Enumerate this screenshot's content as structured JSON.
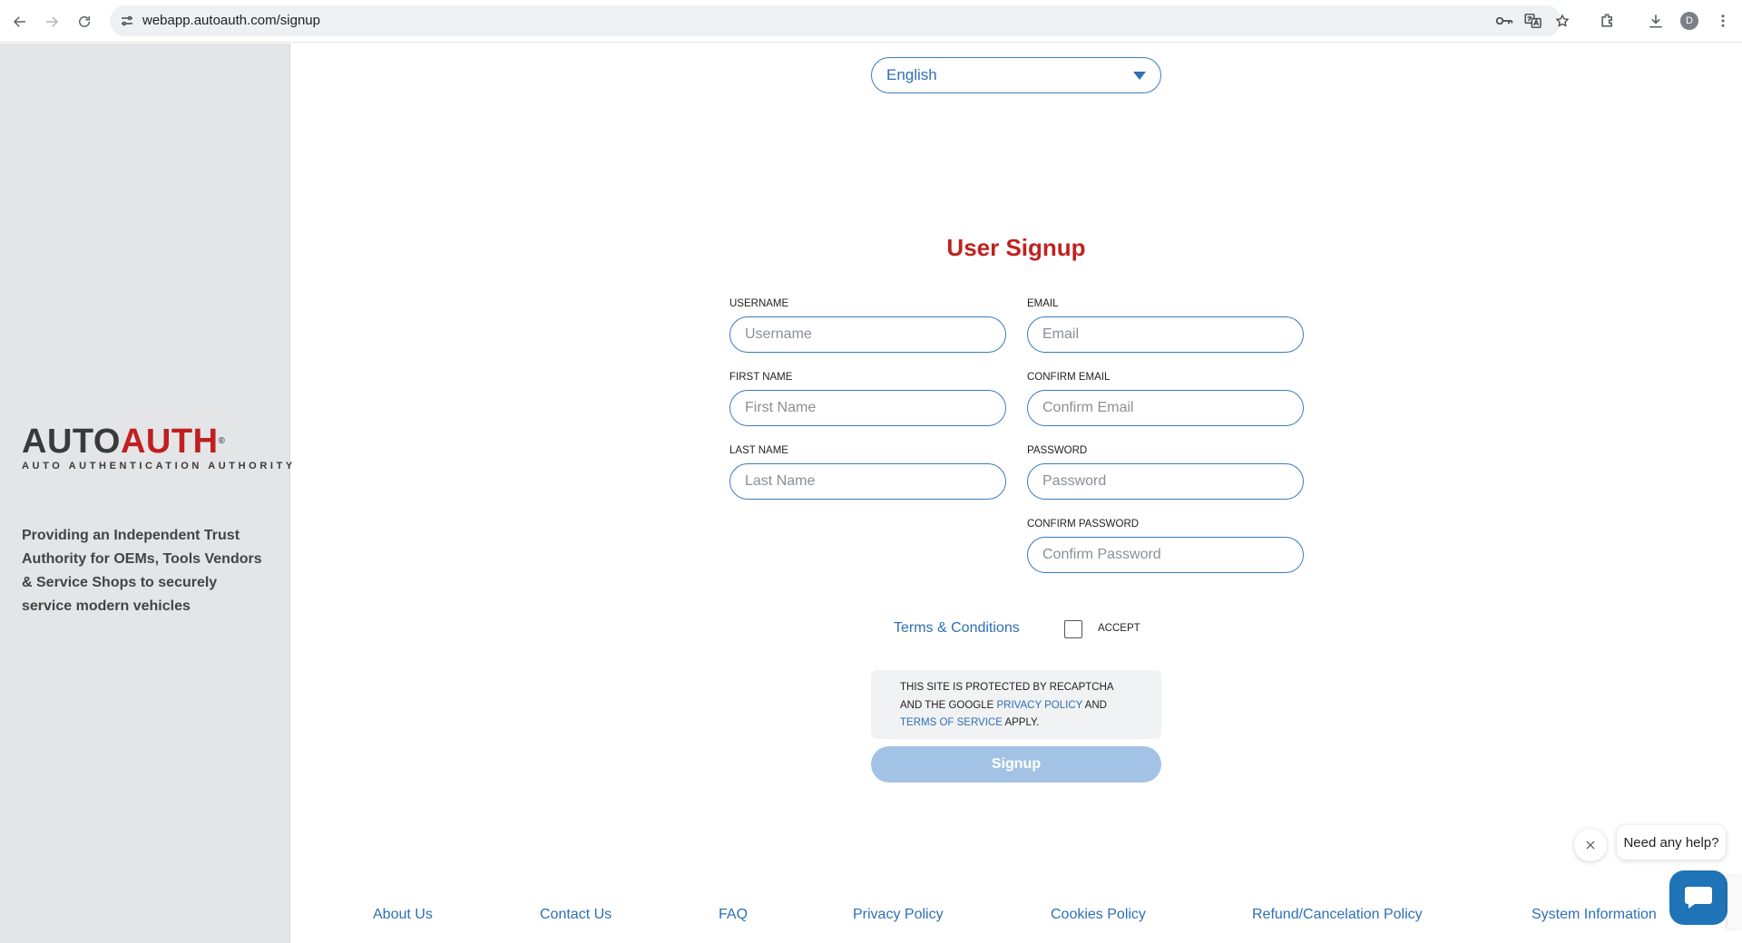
{
  "browser": {
    "url": "webapp.autoauth.com/signup",
    "avatar_letter": "D"
  },
  "sidebar": {
    "logo": {
      "word_a": "AUTO",
      "word_b": "AUTH",
      "registered": "®",
      "subtitle": "AUTO AUTHENTICATION AUTHORITY"
    },
    "tagline": "Providing an Independent Trust Authority for OEMs, Tools Vendors & Service Shops to securely service modern vehicles"
  },
  "language": {
    "selected": "English"
  },
  "form": {
    "title": "User Signup",
    "fields": {
      "username": {
        "label": "USERNAME",
        "placeholder": "Username"
      },
      "email": {
        "label": "EMAIL",
        "placeholder": "Email"
      },
      "first_name": {
        "label": "FIRST NAME",
        "placeholder": "First Name"
      },
      "confirm_email": {
        "label": "CONFIRM EMAIL",
        "placeholder": "Confirm Email"
      },
      "last_name": {
        "label": "LAST NAME",
        "placeholder": "Last Name"
      },
      "password": {
        "label": "PASSWORD",
        "placeholder": "Password"
      },
      "confirm_password": {
        "label": "CONFIRM PASSWORD",
        "placeholder": "Confirm Password"
      }
    },
    "terms_link": "Terms & Conditions",
    "accept_label": "ACCEPT",
    "recaptcha": {
      "part1": "This site is protected by reCAPTCHA and the Google ",
      "privacy": "Privacy Policy",
      "and": " and ",
      "terms": "Terms of Service",
      "part2": " apply."
    },
    "submit": "Signup"
  },
  "footer": {
    "links": [
      "About Us",
      "Contact Us",
      "FAQ",
      "Privacy Policy",
      "Cookies Policy",
      "Refund/Cancelation Policy",
      "System Information"
    ]
  },
  "help": {
    "bubble": "Need any help?"
  },
  "colors": {
    "accent": "#2e6fb5",
    "title_red": "#c0211f",
    "button_disabled": "#a2c3e6",
    "sidebar_bg": "#e3e5e6"
  }
}
